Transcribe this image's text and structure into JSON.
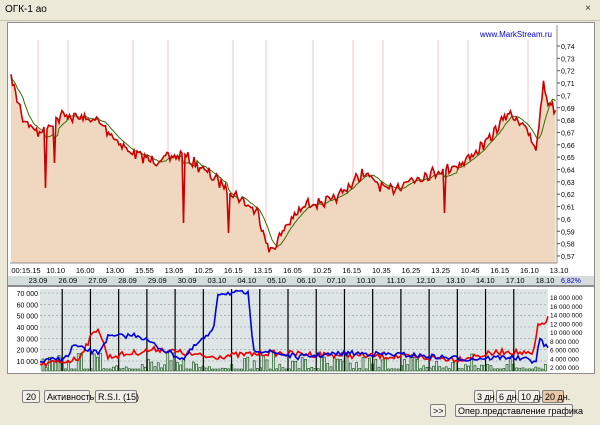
{
  "window": {
    "title": "ОГК-1 ао",
    "close_glyph": "×"
  },
  "watermark": "www.MarkStream.ru",
  "main_chart": {
    "price_ticks": [
      "0,74",
      "0,73",
      "0,72",
      "0,71",
      "0,7",
      "0,69",
      "0,68",
      "0,67",
      "0,66",
      "0,65",
      "0,64",
      "0,63",
      "0,62",
      "0,61",
      "0,6",
      "0,59",
      "0,58",
      "0,57"
    ],
    "time_ticks": [
      "00:15.15",
      "10.10",
      "16.00",
      "13.00",
      "15.55",
      "13.05",
      "10.25",
      "16.15",
      "13.15",
      "16.05",
      "10.25",
      "16.15",
      "10.35",
      "16.25",
      "13.25",
      "10.45",
      "16.15",
      "16.10",
      "13.10"
    ],
    "date_ticks": [
      "23.09",
      "26.09",
      "27.09",
      "28.09",
      "29.09",
      "30.09",
      "03.10",
      "04.10",
      "05.10",
      "06.10",
      "07.10",
      "10.10",
      "11.10",
      "12.10",
      "13.10",
      "14.10",
      "17.10",
      "18.10"
    ],
    "change_label": "6,82%"
  },
  "oscillator": {
    "left_ticks": [
      "70 000",
      "60 000",
      "50 000",
      "40 000",
      "30 000",
      "20 000",
      "10 000"
    ],
    "right_ticks": [
      "18 000 000",
      "16 000 000",
      "14 000 000",
      "12 000 000",
      "10 000 000",
      "8 000 000",
      "6 000 000",
      "4 000 000",
      "2 000 000"
    ]
  },
  "toolbar": {
    "period_value": "20",
    "activity_label": "Активность",
    "rsi_label": "R.S.I.  (15)",
    "scroll_label": ">>",
    "range_3d": "3 дн.",
    "range_6d": "6 дн.",
    "range_10d": "10 дн.",
    "range_20d": "20 дн.",
    "chart_options_label": "Опер.представление графика"
  },
  "colors": {
    "price_line": "#cc0000",
    "price_fill": "#f0d7c0",
    "moving_average": "#3a6e00",
    "rsi_line": "#0000dd",
    "volume_line": "#ee0000",
    "osc_background": "#dde5e5",
    "watermark": "#0000cc"
  }
}
